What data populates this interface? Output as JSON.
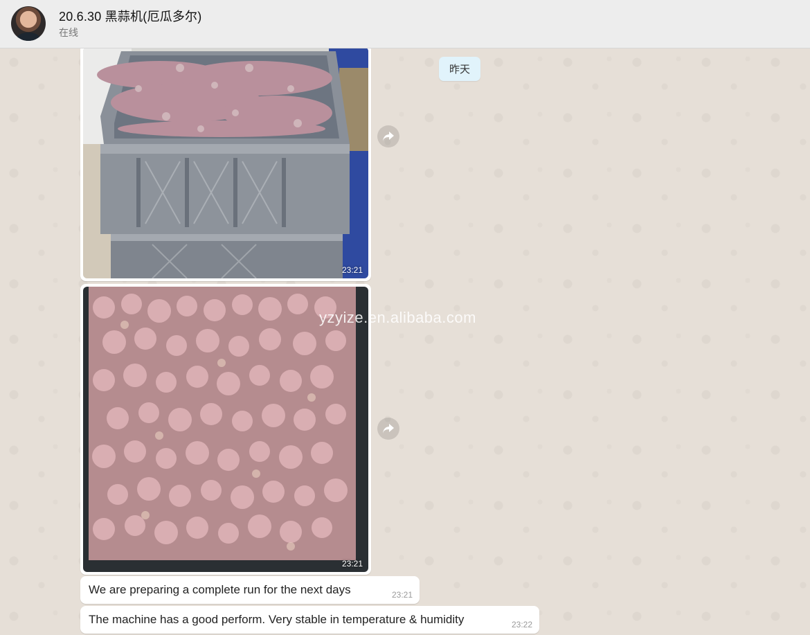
{
  "header": {
    "contact_name": "20.6.30 黑蒜机(厄瓜多尔)",
    "status": "在线"
  },
  "chat": {
    "date_chip": "昨天",
    "watermark": "yzyize.en.alibaba.com",
    "messages": [
      {
        "type": "image",
        "description_icon": "crate-photo",
        "time": "23:21"
      },
      {
        "type": "image",
        "description_icon": "garlic-photo",
        "time": "23:21"
      },
      {
        "type": "text",
        "text": "We are preparing a complete run for the next days",
        "time": "23:21"
      },
      {
        "type": "text",
        "text": "The machine has a good perform. Very stable in temperature & humidity",
        "time": "23:22"
      }
    ]
  },
  "icons": {
    "forward": "share-forward-icon"
  }
}
